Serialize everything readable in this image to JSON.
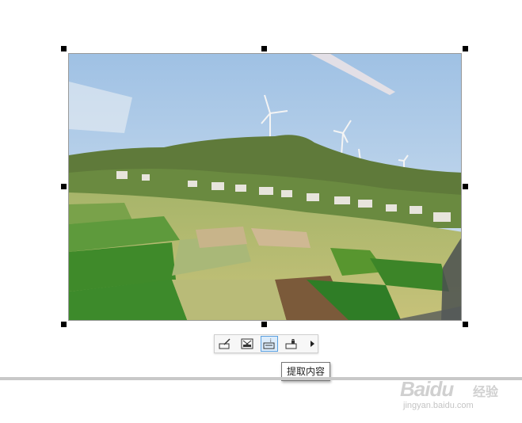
{
  "image": {
    "description_name": "landscape-photo"
  },
  "toolbar": {
    "buttons": [
      {
        "name": "edit-image-button",
        "icon": "pencil-edit-icon"
      },
      {
        "name": "cancel-crop-button",
        "icon": "image-cross-icon"
      },
      {
        "name": "extract-content-button",
        "icon": "text-extract-icon",
        "active": true
      },
      {
        "name": "lock-image-button",
        "icon": "lock-icon"
      }
    ],
    "more_icon": "triangle-right-icon"
  },
  "tooltip": {
    "text": "提取内容"
  },
  "watermark": {
    "brand": "Baidu",
    "brand_suffix": "经验",
    "url": "jingyan.baidu.com"
  },
  "colors": {
    "selection_handle": "#000000",
    "active_button_border": "#5aa0e0",
    "active_button_fill": "#dcecfb",
    "divider_line": "#c8c8c8"
  }
}
